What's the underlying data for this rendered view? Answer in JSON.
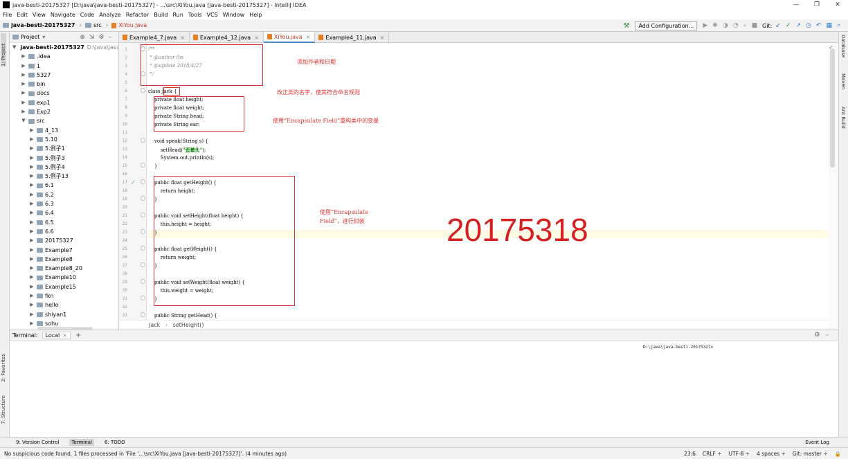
{
  "window": {
    "title": "java-besti-20175327 [D:\\java\\java-besti-20175327] - ...\\src\\XiYou.java [java-besti-20175327] - IntelliJ IDEA",
    "minimize": "—",
    "maximize": "❐",
    "close": "✕"
  },
  "menu": [
    "File",
    "Edit",
    "View",
    "Navigate",
    "Code",
    "Analyze",
    "Refactor",
    "Build",
    "Run",
    "Tools",
    "VCS",
    "Window",
    "Help"
  ],
  "navbar": {
    "project": "java-besti-20175327",
    "folder": "src",
    "file": "XiYou.java",
    "add_configuration": "Add Configuration...",
    "git_label": "Git:"
  },
  "left_strip": {
    "project": "1: Project",
    "favorites": "2: Favorites",
    "structure": "7: Structure"
  },
  "right_strip": {
    "database": "Database",
    "maven": "Maven",
    "ant": "Ant Build"
  },
  "project_panel": {
    "title": "Project",
    "root": {
      "label": "java-besti-20175327",
      "path": "D:\\java\\java-besti-2"
    },
    "items": [
      {
        "label": ".idea",
        "indent": 1,
        "open": false
      },
      {
        "label": "1",
        "indent": 1,
        "open": false
      },
      {
        "label": "5327",
        "indent": 1,
        "open": false
      },
      {
        "label": "bin",
        "indent": 1,
        "open": false
      },
      {
        "label": "docs",
        "indent": 1,
        "open": false
      },
      {
        "label": "exp1",
        "indent": 1,
        "open": false
      },
      {
        "label": "Exp2",
        "indent": 1,
        "open": false
      },
      {
        "label": "src",
        "indent": 1,
        "open": true
      },
      {
        "label": "4_13",
        "indent": 2,
        "open": false
      },
      {
        "label": "5.10",
        "indent": 2,
        "open": false
      },
      {
        "label": "5.例子1",
        "indent": 2,
        "open": false
      },
      {
        "label": "5.例子3",
        "indent": 2,
        "open": false
      },
      {
        "label": "5.例子4",
        "indent": 2,
        "open": false
      },
      {
        "label": "5.例子13",
        "indent": 2,
        "open": false
      },
      {
        "label": "6.1",
        "indent": 2,
        "open": false
      },
      {
        "label": "6.2",
        "indent": 2,
        "open": false
      },
      {
        "label": "6.3",
        "indent": 2,
        "open": false
      },
      {
        "label": "6.4",
        "indent": 2,
        "open": false
      },
      {
        "label": "6.5",
        "indent": 2,
        "open": false
      },
      {
        "label": "6.6",
        "indent": 2,
        "open": false
      },
      {
        "label": "20175327",
        "indent": 2,
        "open": false
      },
      {
        "label": "Example7",
        "indent": 2,
        "open": false
      },
      {
        "label": "Example8",
        "indent": 2,
        "open": false
      },
      {
        "label": "Example8_20",
        "indent": 2,
        "open": false
      },
      {
        "label": "Example10",
        "indent": 2,
        "open": false
      },
      {
        "label": "Example15",
        "indent": 2,
        "open": false
      },
      {
        "label": "fkn",
        "indent": 2,
        "open": false
      },
      {
        "label": "hello",
        "indent": 2,
        "open": false
      },
      {
        "label": "shiyan1",
        "indent": 2,
        "open": false
      },
      {
        "label": "sohu",
        "indent": 2,
        "open": false
      }
    ]
  },
  "tabs": [
    {
      "label": "Example4_7.java",
      "active": false
    },
    {
      "label": "Example4_12.java",
      "active": false
    },
    {
      "label": "XiYou.java",
      "active": true
    },
    {
      "label": "Example4_11.java",
      "active": false
    }
  ],
  "code": {
    "line_numbers": [
      "1",
      "2",
      "3",
      "4",
      "5",
      "6",
      "7",
      "8",
      "9",
      "10",
      "11",
      "12",
      "13",
      "14",
      "15",
      "16",
      "17",
      "18",
      "19",
      "20",
      "21",
      "22",
      "23",
      "24",
      "25",
      "26",
      "27",
      "28",
      "29",
      "30",
      "31",
      "32",
      "33"
    ],
    "comment_open": "/**",
    "author": " * @author lhs",
    "update": " * @update 2018/4/27",
    "comment_close": " */",
    "class_decl": "class Jack {",
    "f1": "    private float height;",
    "f2": "    private float weight;",
    "f3": "    private String head;",
    "f4": "    private String ear;",
    "speak": "    void speak(String s) {",
    "sethead_a": "        setHead(",
    "sethead_str": "\"歪着头\"",
    "sethead_b": ");",
    "println": "        System.out.println(s);",
    "close1": "    }",
    "getheight": "    public float getHeight() {",
    "ret_height": "        return height;",
    "close2": "    }",
    "setheight": "    public void setHeight(float height) {",
    "assign_height": "        this.height = height;",
    "close3": "    }",
    "getweight": "    public float getWeight() {",
    "ret_weight": "        return weight;",
    "close4": "    }",
    "setweight": "    public void setWeight(float weight) {",
    "assign_weight": "        this.weight = weight;",
    "close5": "    }",
    "gethead": "    public String getHead() {"
  },
  "annotations": {
    "note1": "添加作者和日期",
    "note2": "改正类的名字，使其符合命名规则",
    "note3": "使用“Encapsulate Field”重构类中的变量",
    "note4_line1": "使用“Encapsulate",
    "note4_line2": "Field”，进行封装",
    "big_number": "20175318"
  },
  "breadcrumb": {
    "cls": "Jack",
    "sep": "›",
    "method": "setHeight()"
  },
  "terminal": {
    "label": "Terminal:",
    "tab": "Local",
    "prompt": "D:\\java\\java-besti-20175327>"
  },
  "tool_windows": {
    "version_control": "9: Version Control",
    "terminal": "Terminal",
    "todo": "6: TODO",
    "event_log": "Event Log"
  },
  "status": {
    "message": "No suspicious code found. 1 files processed in 'File '...\\src\\XiYou.java [java-besti-20175327]'. (4 minutes ago)",
    "position": "23:6",
    "line_sep": "CRLF ÷",
    "encoding": "UTF-8 ÷",
    "indent": "4 spaces ÷",
    "git": "Git: master ÷"
  },
  "colors": {
    "annotation_red": "#d33333",
    "big_number_red": "#d42020",
    "keyword": "#000080",
    "string": "#008000"
  }
}
